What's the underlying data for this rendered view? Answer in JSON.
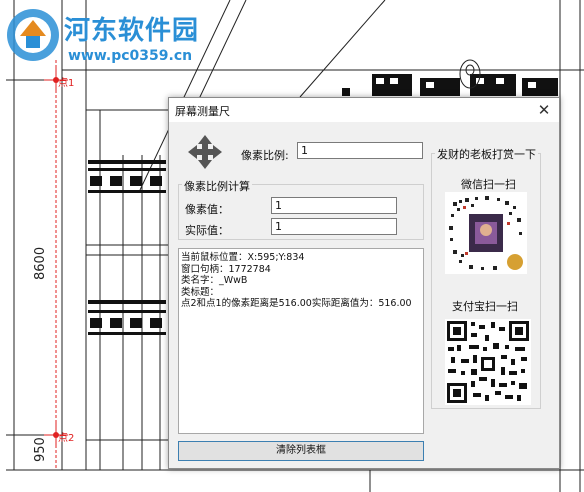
{
  "watermark": {
    "title": "河东软件园",
    "url": "www.pc0359.cn"
  },
  "cad": {
    "dim_8600": "8600",
    "dim_950": "950",
    "point1_label": "点1",
    "point2_label": "点2"
  },
  "dialog": {
    "title": "屏幕测量尺",
    "close_glyph": "✕",
    "scale_label": "像素比例:",
    "scale_value": "1",
    "calc_group_title": "像素比例计算",
    "pixel_label": "像素值：",
    "pixel_value": "1",
    "actual_label": "实际值：",
    "actual_value": "1",
    "output_lines": [
      "当前鼠标位置：X:595;Y:834",
      "窗口句柄：1772784",
      "类名字：_WwB",
      "类标题：",
      "点2和点1的像素距离是516.00实际距离值为：516.00"
    ],
    "clear_button": "清除列表框",
    "donate_group_title": "发财的老板打赏一下",
    "wechat_label": "微信扫一扫",
    "alipay_label": "支付宝扫一扫"
  },
  "colors": {
    "watermark_blue": "#2a8fd6",
    "point_red": "#e02020"
  }
}
